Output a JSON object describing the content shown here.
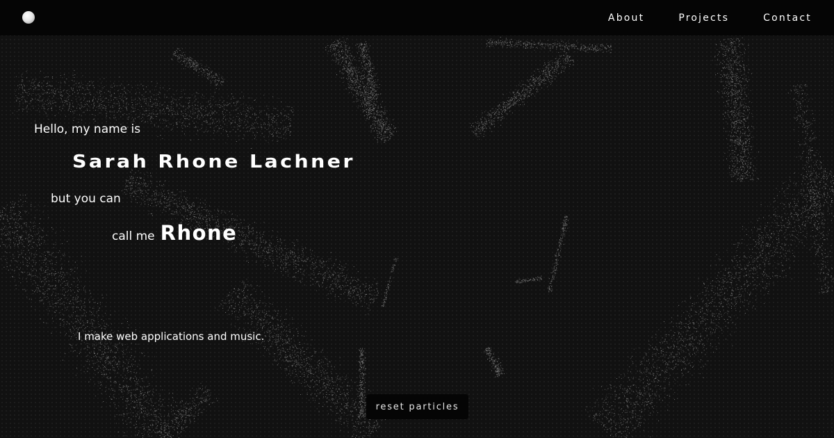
{
  "nav": {
    "logo_icon": "white-circle-logo",
    "links": [
      "About",
      "Projects",
      "Contact"
    ]
  },
  "hero": {
    "intro": "Hello, my name is",
    "full_name": "Sarah Rhone Lachner",
    "but_line": "but you can",
    "call_me": "call me",
    "nickname": "Rhone",
    "tagline": "I make web applications and music."
  },
  "controls": {
    "reset_label": "reset particles"
  },
  "colors": {
    "background": "#111111",
    "navbar": "#050505",
    "text": "#ffffff",
    "particles": "#8a8a8a"
  }
}
